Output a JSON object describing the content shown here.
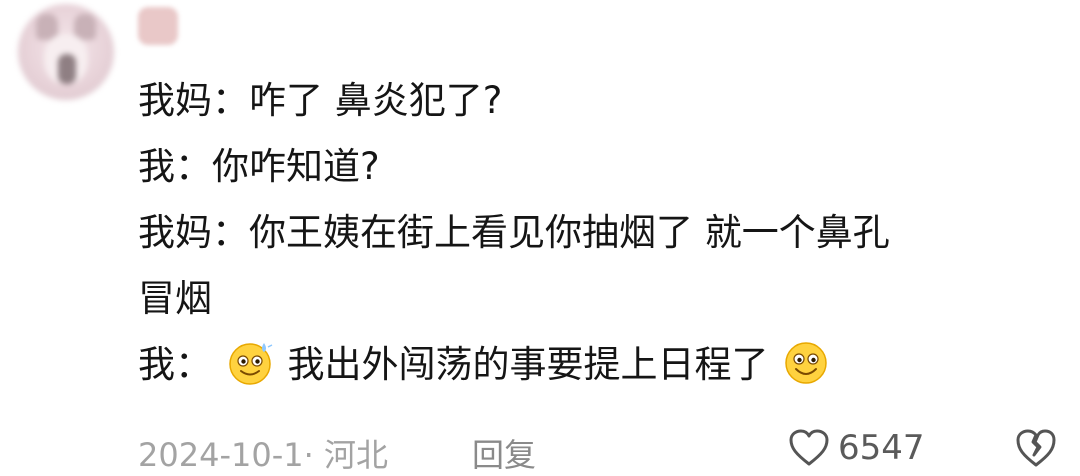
{
  "comment": {
    "lines": [
      "我妈：咋了  鼻炎犯了?",
      "我：你咋知道?",
      "我妈：你王姨在街上看见你抽烟了  就一个鼻孔",
      "冒烟"
    ],
    "last_line": {
      "prefix": "我：",
      "emoji_left": "sweat-smile-emoji",
      "text": "我出外闯荡的事要提上日程了",
      "emoji_right": "grin-emoji"
    }
  },
  "meta": {
    "date_location": "2024-10-1· 河北",
    "reply_label": "回复",
    "like_icon": "heart-outline-icon",
    "like_count": "6547",
    "dislike_icon": "broken-heart-icon"
  },
  "colors": {
    "text": "#151515",
    "meta": "#a3a3a3",
    "emoji_fill": "#ffd23f"
  }
}
